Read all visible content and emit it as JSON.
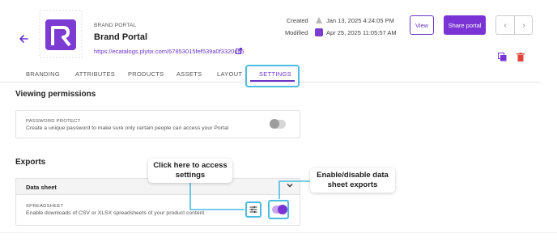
{
  "header": {
    "back_icon": "arrow-left-icon",
    "kicker": "BRAND PORTAL",
    "title": "Brand Portal",
    "url": "https://ecatalogs.plytix.com/67853015fef539a0f3320c65",
    "external_icon": "external-link-icon",
    "created_label": "Created",
    "created_value": "Jan 13, 2025 4:24:05 PM",
    "modified_label": "Modified",
    "modified_value": "Apr 25, 2025 11:05:57 AM",
    "view_label": "View",
    "share_label": "Share portal",
    "prev_icon": "chevron-left-icon",
    "next_icon": "chevron-right-icon",
    "copy_icon": "copy-icon",
    "delete_icon": "trash-icon",
    "accent_color": "#7a33d4"
  },
  "tabs": [
    {
      "label": "BRANDING",
      "active": false
    },
    {
      "label": "ATTRIBUTES",
      "active": false
    },
    {
      "label": "PRODUCTS",
      "active": false
    },
    {
      "label": "ASSETS",
      "active": false
    },
    {
      "label": "LAYOUT",
      "active": false
    },
    {
      "label": "SETTINGS",
      "active": true
    }
  ],
  "viewing": {
    "heading": "Viewing permissions",
    "kicker": "PASSWORD PROTECT",
    "description": "Create a unique password to make sure only certain people can access your Portal",
    "toggle_on": false
  },
  "exports": {
    "heading": "Exports",
    "data_sheet_title": "Data sheet",
    "spreadsheet_kicker": "SPREADSHEET",
    "spreadsheet_description": "Enable downloads of CSV or XLSX spreadsheets of your product content",
    "settings_icon": "sliders-icon",
    "toggle_on": true
  },
  "callouts": {
    "settings": "Click here to access settings",
    "toggle": "Enable/disable data sheet exports",
    "highlight_color": "#4bbde0"
  }
}
